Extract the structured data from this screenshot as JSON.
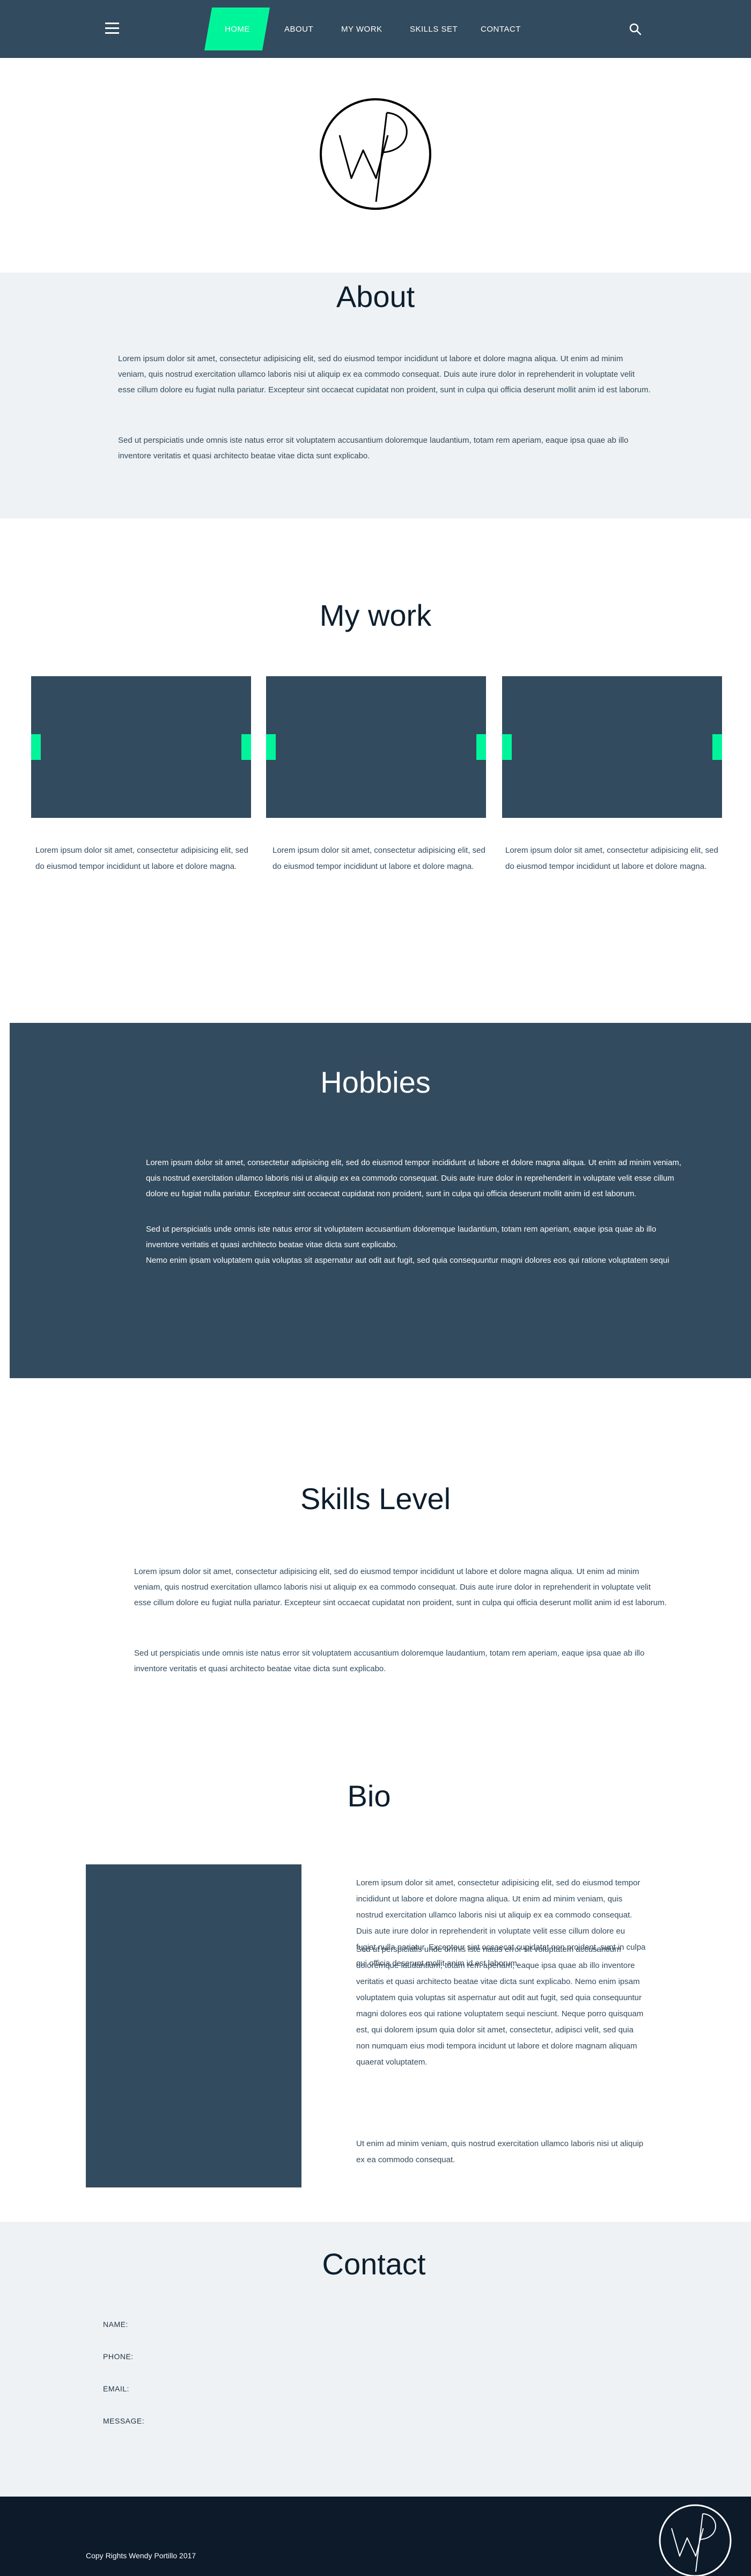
{
  "nav": {
    "home": "HOME",
    "about": "ABOUT",
    "my_work": "MY WORK",
    "skills_set": "SKILLS SET",
    "contact": "CONTACT",
    "active": "HOME",
    "menu_icon": "hamburger-menu-icon",
    "search_icon": "search-icon"
  },
  "logo": {
    "letters": "WP"
  },
  "about": {
    "title": "About",
    "p1": "Lorem ipsum dolor sit amet, consectetur adipisicing elit, sed do eiusmod tempor incididunt ut labore et dolore magna aliqua. Ut enim ad minim veniam, quis nostrud exercitation ullamco laboris nisi ut aliquip ex ea commodo consequat. Duis aute irure dolor in reprehenderit in voluptate velit esse cillum dolore eu fugiat nulla pariatur. Excepteur sint occaecat cupidatat non proident, sunt in culpa qui officia deserunt mollit anim id est laborum.",
    "p2": "Sed ut perspiciatis unde omnis iste natus error sit voluptatem accusantium doloremque laudantium, totam rem aperiam, eaque ipsa quae ab illo inventore veritatis et quasi architecto beatae vitae dicta sunt explicabo."
  },
  "work": {
    "title": "My work",
    "captions": [
      "Lorem ipsum dolor sit amet, consectetur adipisicing elit, sed do eiusmod tempor incididunt ut labore et dolore magna.",
      "Lorem ipsum dolor sit amet, consectetur adipisicing elit, sed do eiusmod tempor incididunt ut labore et dolore magna.",
      "Lorem ipsum dolor sit amet, consectetur adipisicing elit, sed do eiusmod tempor incididunt ut labore et dolore magna."
    ]
  },
  "hobbies": {
    "title": "Hobbies",
    "p1": "Lorem ipsum dolor sit amet, consectetur adipisicing elit, sed do eiusmod tempor incididunt ut labore et dolore magna aliqua. Ut enim ad minim veniam, quis nostrud exercitation ullamco laboris nisi ut aliquip ex ea commodo consequat. Duis aute irure dolor in reprehenderit in voluptate velit esse cillum dolore eu fugiat nulla pariatur. Excepteur sint occaecat cupidatat non proident, sunt in culpa qui officia deserunt mollit anim id est laborum.",
    "p2": "Sed ut perspiciatis unde omnis iste natus error sit voluptatem accusantium doloremque laudantium, totam rem aperiam, eaque ipsa quae ab illo inventore veritatis et quasi architecto beatae vitae dicta sunt explicabo.",
    "p3": "Nemo enim ipsam voluptatem quia voluptas sit aspernatur aut odit aut fugit, sed quia consequuntur magni dolores eos qui ratione voluptatem sequi"
  },
  "skills": {
    "title": "Skills Level",
    "p1": "Lorem ipsum dolor sit amet, consectetur adipisicing elit, sed do eiusmod tempor incididunt ut labore et dolore magna aliqua. Ut enim ad minim veniam, quis nostrud exercitation ullamco laboris nisi ut aliquip ex ea commodo consequat. Duis aute irure dolor in reprehenderit in voluptate velit esse cillum dolore eu fugiat nulla pariatur. Excepteur sint occaecat cupidatat non proident, sunt in culpa qui officia deserunt mollit anim id est laborum.",
    "p2": "Sed ut perspiciatis unde omnis iste natus error sit voluptatem accusantium doloremque laudantium, totam rem aperiam, eaque ipsa quae ab illo inventore veritatis et quasi architecto beatae vitae dicta sunt explicabo."
  },
  "bio": {
    "title": "Bio",
    "p1": "Lorem ipsum dolor sit amet, consectetur adipisicing elit, sed do eiusmod tempor incididunt ut labore et dolore magna aliqua. Ut enim ad minim veniam, quis nostrud exercitation ullamco laboris nisi ut aliquip ex ea commodo consequat. Duis aute irure dolor in reprehenderit in voluptate velit esse cillum dolore eu fugiat nulla pariatur. Excepteur sint occaecat cupidatat non proident, sunt in culpa qui officia deserunt mollit anim id est laborum.",
    "p2": "Sed ut perspiciatis unde omnis iste natus error sit voluptatem accusantium doloremque laudantium, totam rem aperiam, eaque ipsa quae ab illo inventore veritatis et quasi architecto beatae vitae dicta sunt explicabo. Nemo enim ipsam voluptatem quia voluptas sit aspernatur aut odit aut fugit, sed quia consequuntur magni dolores eos qui ratione voluptatem sequi nesciunt. Neque porro quisquam est, qui dolorem ipsum quia dolor sit amet, consectetur, adipisci velit, sed quia non numquam eius modi tempora incidunt ut labore et dolore magnam aliquam quaerat voluptatem.",
    "p3": "Ut enim ad minim veniam, quis nostrud exercitation ullamco laboris nisi ut aliquip ex ea commodo consequat."
  },
  "contact": {
    "title": "Contact",
    "name_label": "NAME:",
    "phone_label": "PHONE:",
    "email_label": "EMAIL:",
    "message_label": "MESSAGE:"
  },
  "footer": {
    "copyright": "Copy Rights Wendy Portillo 2017"
  },
  "colors": {
    "navy": "#334b5e",
    "accent": "#00f59b",
    "light_bg": "#eef2f4",
    "footer_bg": "#0c1a2a"
  }
}
